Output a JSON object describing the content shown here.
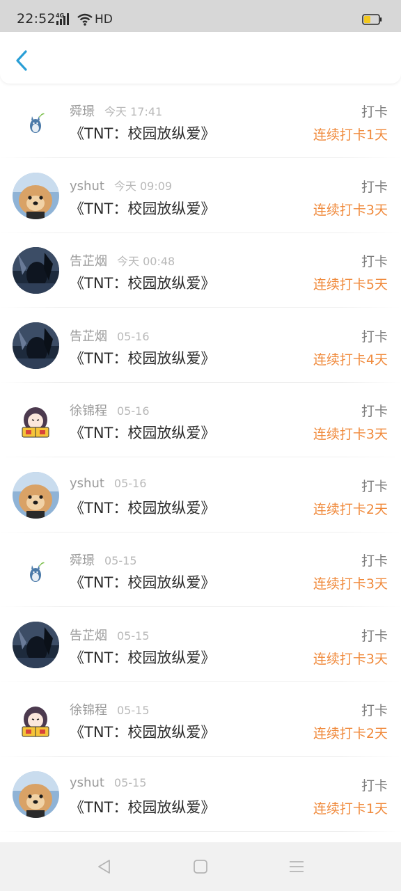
{
  "status_bar": {
    "time": "22:52",
    "network": "4G",
    "hd": "HD",
    "battery_level": 0.45,
    "battery_color": "#f2c81e"
  },
  "header": {
    "back_icon": "chevron-left-icon",
    "accent": "#2a9fd6"
  },
  "colors": {
    "streak": "#f08a3c",
    "action": "#7b7b7b",
    "name": "#9a9a9a"
  },
  "records": [
    {
      "name": "舜璟",
      "time": "今天 17:41",
      "title": "《TNT：校园放纵爱》",
      "action": "打卡",
      "streak": "连续打卡1天",
      "avatar": "totoro"
    },
    {
      "name": "yshut",
      "time": "今天 09:09",
      "title": "《TNT：校园放纵爱》",
      "action": "打卡",
      "streak": "连续打卡3天",
      "avatar": "dog"
    },
    {
      "name": "告芷烟",
      "time": "今天 00:48",
      "title": "《TNT：校园放纵爱》",
      "action": "打卡",
      "streak": "连续打卡5天",
      "avatar": "girl"
    },
    {
      "name": "告芷烟",
      "time": "05-16",
      "title": "《TNT：校园放纵爱》",
      "action": "打卡",
      "streak": "连续打卡4天",
      "avatar": "girl"
    },
    {
      "name": "徐锦程",
      "time": "05-16",
      "title": "《TNT：校园放纵爱》",
      "action": "打卡",
      "streak": "连续打卡3天",
      "avatar": "cartoon"
    },
    {
      "name": "yshut",
      "time": "05-16",
      "title": "《TNT：校园放纵爱》",
      "action": "打卡",
      "streak": "连续打卡2天",
      "avatar": "dog"
    },
    {
      "name": "舜璟",
      "time": "05-15",
      "title": "《TNT：校园放纵爱》",
      "action": "打卡",
      "streak": "连续打卡3天",
      "avatar": "totoro"
    },
    {
      "name": "告芷烟",
      "time": "05-15",
      "title": "《TNT：校园放纵爱》",
      "action": "打卡",
      "streak": "连续打卡3天",
      "avatar": "girl"
    },
    {
      "name": "徐锦程",
      "time": "05-15",
      "title": "《TNT：校园放纵爱》",
      "action": "打卡",
      "streak": "连续打卡2天",
      "avatar": "cartoon"
    },
    {
      "name": "yshut",
      "time": "05-15",
      "title": "《TNT：校园放纵爱》",
      "action": "打卡",
      "streak": "连续打卡1天",
      "avatar": "dog"
    }
  ],
  "nav_bar": {
    "back_icon": "triangle-back-icon",
    "home_icon": "square-home-icon",
    "menu_icon": "menu-lines-icon"
  }
}
